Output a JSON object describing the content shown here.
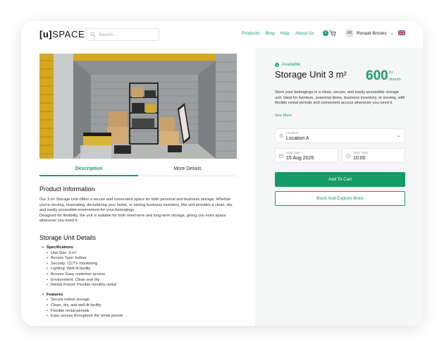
{
  "header": {
    "logo_bracket": "[u]",
    "logo_text": "SPACE",
    "search_placeholder": "Search...",
    "nav": [
      "Products",
      "Blog",
      "Help",
      "About Us"
    ],
    "cart_count": "0",
    "user_initials": "RB",
    "user_name": "Ronald Brooks"
  },
  "tabs": {
    "description": "Description",
    "more_details": "More Details"
  },
  "product_info": {
    "heading": "Product Information",
    "paragraph": "Our 3 m² Storage Unit offers a secure and convenient space for both personal and business storage. Whether you're moving, renovating, decluttering your home, or storing business inventory, this unit provides a clean, dry, and easily accessible environment for your belongings.",
    "paragraph2": "Designed for flexibility, the unit is suitable for both short-term and long-term storage, giving you extra space whenever you need it."
  },
  "details": {
    "heading": "Storage Unit Details",
    "specifications_label": "Specifications",
    "specifications": [
      "Unit Size: 3 m²",
      "Access Type: Indoor",
      "Security: CCTV monitoring",
      "Lighting: Well-lit facility",
      "Access: Easy customer access",
      "Environment: Clean and dry",
      "Rental Period: Flexible monthly rental"
    ],
    "features_label": "Features",
    "features": [
      "Secure indoor storage",
      "Clean, dry, and well-lit facility",
      "Flexible rental periods",
      "Easy access throughout the rental period"
    ]
  },
  "sidebar": {
    "status": "Available",
    "title": "Storage Unit 3 m²",
    "price": "600",
    "currency": "Kr",
    "period": "/month",
    "description": "Store your belongings in a clean, secure, and easily accessible storage unit. Ideal for furniture, seasonal items, business inventory, or moving, with flexible rental periods and convenient access whenever you need it.",
    "see_more": "See More",
    "location_label": "Location",
    "location_value": "Location A",
    "start_date_label": "Start date",
    "start_date_value": "15 Aug 2026",
    "start_time_label": "Start Time",
    "start_time_value": "10:00",
    "add_to_cart": "Add To Cart",
    "book_explore": "Book And Explore More"
  },
  "colors": {
    "accent": "#159b67",
    "text": "#222222"
  }
}
